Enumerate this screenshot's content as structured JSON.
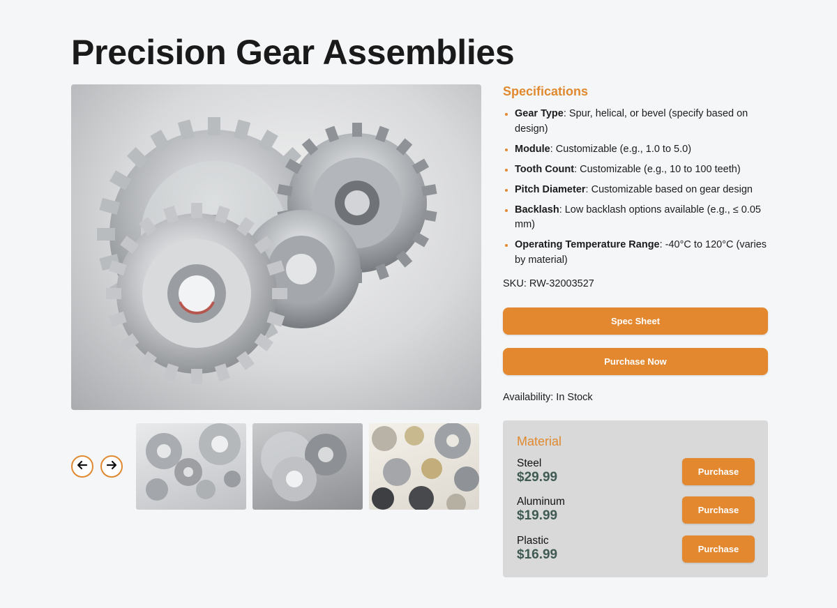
{
  "product": {
    "title": "Precision Gear Assemblies"
  },
  "gallery": {
    "main_image": "silver-gears-photo",
    "prev_icon": "arrow-left-icon",
    "next_icon": "arrow-right-icon",
    "thumbnails": [
      "assorted-silver-gears-photo",
      "silver-gears-photo",
      "mixed-brass-steel-gears-photo"
    ]
  },
  "specifications": {
    "heading": "Specifications",
    "items": [
      {
        "label": "Gear Type",
        "value": ": Spur, helical, or bevel (specify based on design)"
      },
      {
        "label": "Module",
        "value": ": Customizable (e.g., 1.0 to 5.0)"
      },
      {
        "label": "Tooth Count",
        "value": ": Customizable (e.g., 10 to 100 teeth)"
      },
      {
        "label": "Pitch Diameter",
        "value": ": Customizable based on gear design"
      },
      {
        "label": "Backlash",
        "value": ": Low backlash options available (e.g., ≤ 0.05 mm)"
      },
      {
        "label": "Operating Temperature Range",
        "value": ": -40°C to 120°C (varies by material)"
      }
    ],
    "sku": "SKU: RW-32003527"
  },
  "actions": {
    "spec_sheet_label": "Spec Sheet",
    "purchase_now_label": "Purchase Now"
  },
  "availability": "Availability: In Stock",
  "material": {
    "heading": "Material",
    "options": [
      {
        "name": "Steel",
        "price": "$29.99",
        "button": "Purchase"
      },
      {
        "name": "Aluminum",
        "price": "$19.99",
        "button": "Purchase"
      },
      {
        "name": "Plastic",
        "price": "$16.99",
        "button": "Purchase"
      }
    ]
  },
  "colors": {
    "accent": "#e4882f",
    "price": "#3f5a53",
    "background": "#f5f6f8",
    "panel": "#d9d9d9"
  }
}
